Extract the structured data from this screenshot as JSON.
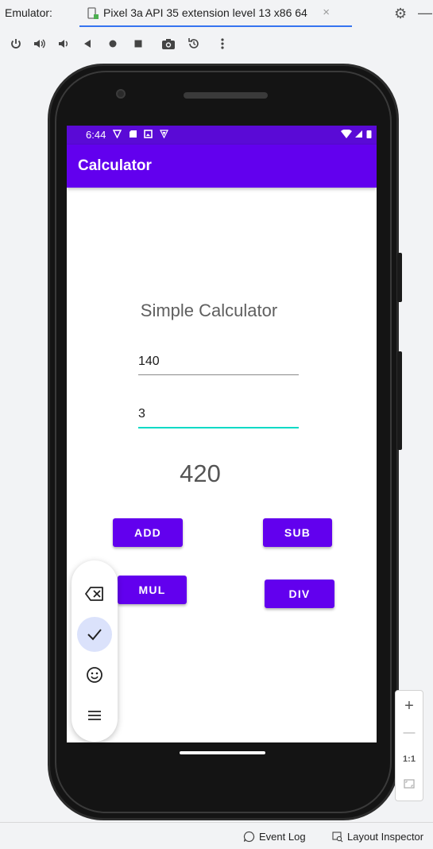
{
  "ide": {
    "label": "Emulator:",
    "tab_title": "Pixel 3a API 35 extension level 13 x86 64",
    "tab_close": "×",
    "settings_icon": "gear-icon",
    "minimize": "—"
  },
  "toolbar": {
    "tools": [
      "power-icon",
      "volume-up-icon",
      "volume-down-icon",
      "back-icon",
      "home-icon",
      "overview-icon",
      "camera-icon",
      "rotate-icon",
      "more-icon"
    ]
  },
  "device": {
    "status_time": "6:44"
  },
  "app": {
    "title": "Calculator",
    "heading": "Simple Calculator",
    "input1": "140",
    "input2": "3",
    "result": "420",
    "buttons": {
      "add": "ADD",
      "sub": "SUB",
      "mul": "MUL",
      "div": "DIV"
    }
  },
  "floatbar": {
    "items": [
      "backspace-icon",
      "check-icon",
      "emoji-icon",
      "menu-icon"
    ]
  },
  "zoom": {
    "plus": "+",
    "minus": "—",
    "one_to_one": "1:1"
  },
  "statusbar": {
    "event_log": "Event Log",
    "layout_inspector": "Layout Inspector"
  },
  "colors": {
    "primary": "#6200ee",
    "status_bar": "#5a0ad6",
    "accent": "#03dac5"
  }
}
